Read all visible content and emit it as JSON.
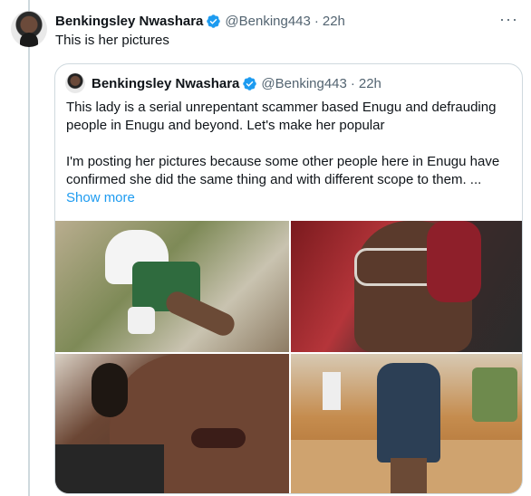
{
  "tweet": {
    "author_name": "Benkingsley Nwashara",
    "handle": "@Benking443",
    "separator": "·",
    "time": "22h",
    "more": "···",
    "text": "This is her pictures"
  },
  "quoted_tweet": {
    "author_name": "Benkingsley Nwashara",
    "handle": "@Benking443",
    "separator": "·",
    "time": "22h",
    "paragraph1": "This lady is a serial unrepentant scammer based Enugu and defrauding people in Enugu and beyond. Let's make her popular",
    "paragraph2": "I'm posting her pictures because some other people here in Enugu have confirmed she did the same thing and with different scope to them.  ...",
    "show_more": "Show more"
  },
  "colors": {
    "verified": "#1d9bf0",
    "link": "#1d9bf0",
    "muted": "#536471",
    "border": "#cfd9de"
  },
  "icons": {
    "verified": "verified-badge-icon",
    "more": "more-options-icon"
  }
}
